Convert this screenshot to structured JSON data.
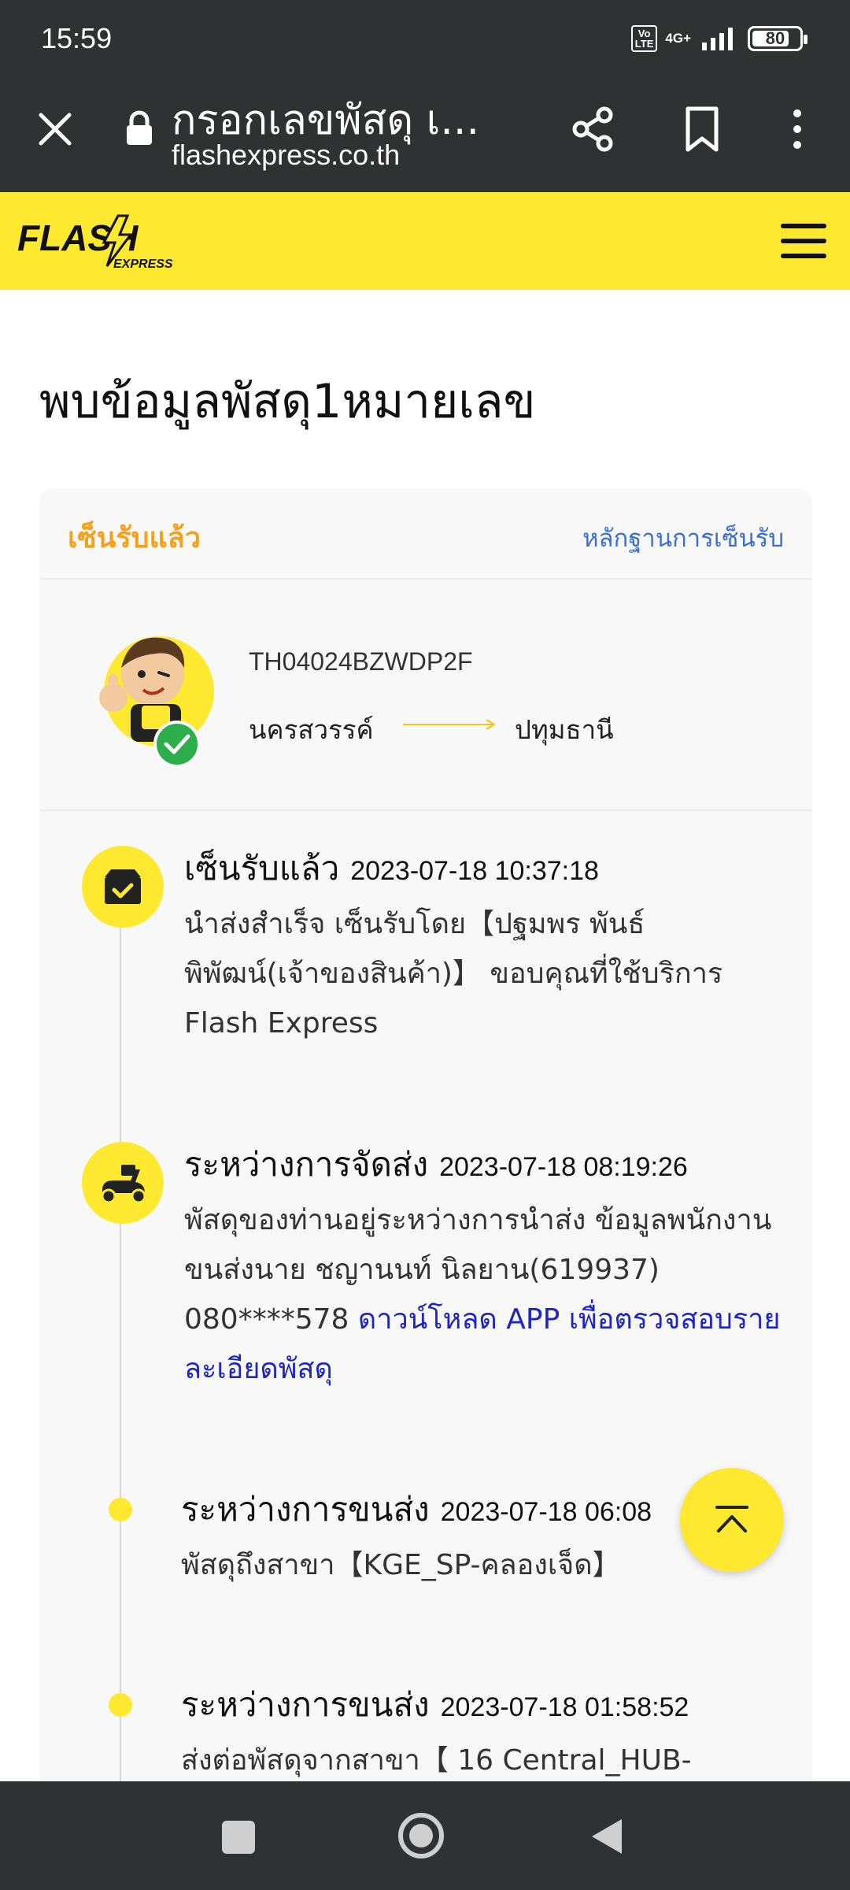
{
  "status_bar": {
    "time": "15:59",
    "volte": "Vo LTE",
    "network": "4G+",
    "battery": "80",
    "battery_level": 0.8
  },
  "browser": {
    "title": "กรอกเลขพัสดุ เ...",
    "domain": "flashexpress.co.th"
  },
  "header": {
    "logo_text": "FLASH",
    "logo_sub": "EXPRESS"
  },
  "result": {
    "title": "พบข้อมูลพัสดุ1หมายเลข",
    "status_label": "เซ็นรับแล้ว",
    "proof_link": "หลักฐานการเซ็นรับ",
    "tracking_number": "TH04024BZWDP2F",
    "origin": "นครสวรรค์",
    "destination": "ปทุมธานี"
  },
  "timeline": [
    {
      "status": "เซ็นรับแล้ว",
      "time": "2023-07-18 10:37:18",
      "desc": "นำส่งสำเร็จ เซ็นรับโดย【ปฐมพร พันธ์พิพัฒน์(เจ้าของสินค้า)】 ขอบคุณที่ใช้บริการ Flash Express"
    },
    {
      "status": "ระหว่างการจัดส่ง",
      "time": "2023-07-18 08:19:26",
      "desc": "พัสดุของท่านอยู่ระหว่างการนำส่ง ข้อมูลพนักงานขนส่งนาย ชญานนท์ นิลยาน(619937) 080****578 ",
      "link": "ดาวน์โหลด APP เพื่อตรวจสอบรายละเอียดพัสดุ"
    },
    {
      "status": "ระหว่างการขนส่ง",
      "time": "2023-07-18 06:08",
      "desc": "พัสดุถึงสาขา【KGE_SP-คลองเจ็ด】"
    },
    {
      "status": "ระหว่างการขนส่ง",
      "time": "2023-07-18 01:58:52",
      "desc": "ส่งต่อพัสดุจากสาขา【 16 Central_HUB-"
    }
  ],
  "colors": {
    "brand_yellow": "#ffe930",
    "status_orange": "#f5a11b",
    "link_blue": "#3a6fd8",
    "download_link": "#1d25c4",
    "dark_bar": "#303133"
  },
  "icons": [
    "close-icon",
    "lock-icon",
    "share-icon",
    "bookmark-icon",
    "more-vert-icon",
    "hamburger-icon",
    "box-check-icon",
    "scooter-icon",
    "chevron-up-icon",
    "check-icon"
  ]
}
